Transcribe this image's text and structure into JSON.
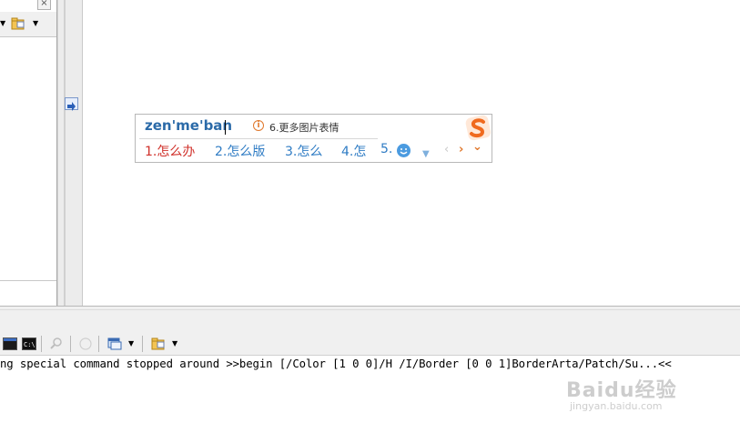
{
  "ime": {
    "pinyin": "zen'me'ban",
    "hint_icon": "info-icon",
    "hint_text": "6.更多图片表情",
    "candidates": [
      "1.怎么办",
      "2.怎么版",
      "3.怎么",
      "4.怎"
    ],
    "candidate_5_label": "5.",
    "candidate_5_icon": "smiley-icon",
    "prev_arrow": "‹",
    "next_arrow": "›",
    "expand_arrow": "⌄",
    "logo": "sogou-logo",
    "colors": {
      "pinyin": "#2b6aa8",
      "first_candidate": "#d0302a",
      "candidates": "#2f7cc4",
      "accent": "#e0782c"
    }
  },
  "output": {
    "line": "ng special command stopped around >>begin [/Color [1 0 0]/H /I/Border [0 0 1]BorderArta/Patch/Su...<<"
  },
  "watermark": {
    "brand": "Baidu经验",
    "url": "jingyan.baidu.com"
  },
  "icons": {
    "panel_close": "close-icon",
    "splitter": "arrow-right-icon"
  }
}
